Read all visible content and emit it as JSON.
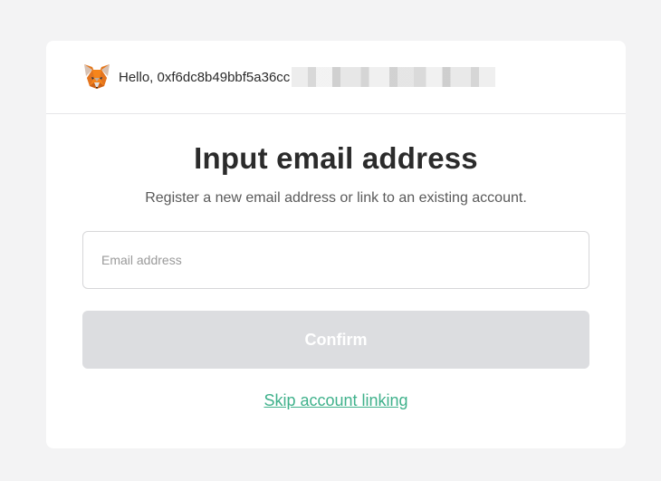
{
  "header": {
    "greeting": "Hello, 0xf6dc8b49bbf5a36cc",
    "logo_icon": "metamask-fox-icon"
  },
  "main": {
    "title": "Input email address",
    "subtitle": "Register a new email address or link to an existing account.",
    "email_field": {
      "placeholder": "Email address",
      "value": ""
    },
    "confirm_label": "Confirm",
    "skip_label": "Skip account linking"
  },
  "colors": {
    "background": "#f3f3f4",
    "card": "#ffffff",
    "confirm_disabled_bg": "#dcdde0",
    "link": "#3fb18b",
    "title_text": "#2b2b2b"
  }
}
